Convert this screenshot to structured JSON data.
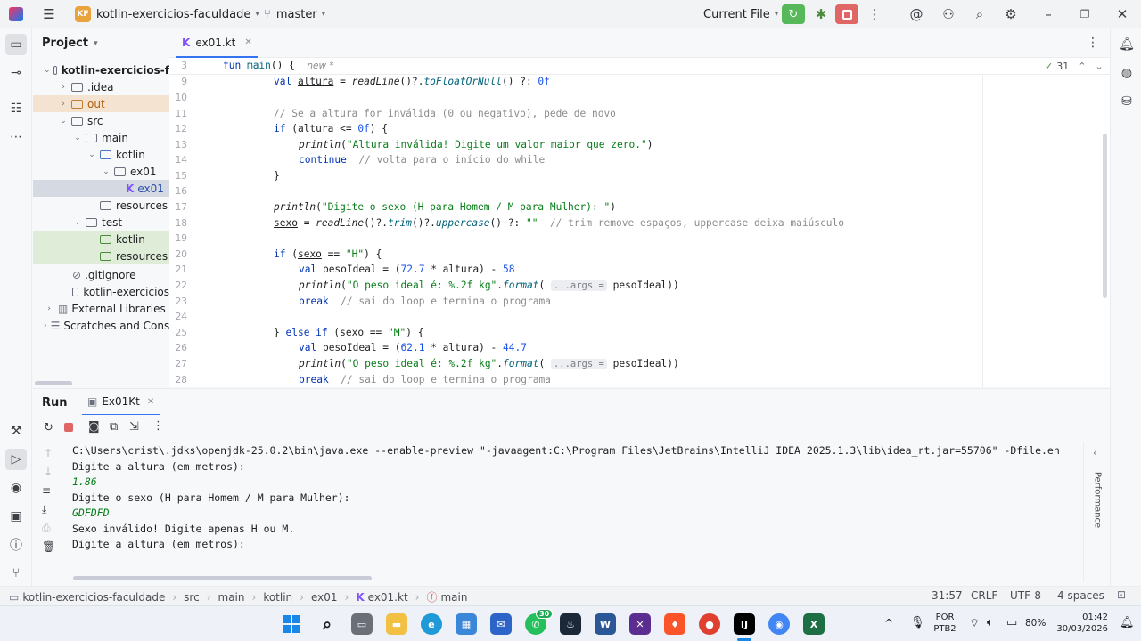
{
  "titlebar": {
    "project_badge": "KF",
    "project_name": "kotlin-exercicios-faculdade",
    "branch": "master",
    "run_config": "Current File"
  },
  "project_panel": {
    "title": "Project",
    "rows": [
      {
        "label": "kotlin-exercicios-f"
      },
      {
        "label": ".idea"
      },
      {
        "label": "out"
      },
      {
        "label": "src"
      },
      {
        "label": "main"
      },
      {
        "label": "kotlin"
      },
      {
        "label": "ex01"
      },
      {
        "label": "ex01"
      },
      {
        "label": "resources"
      },
      {
        "label": "test"
      },
      {
        "label": "kotlin"
      },
      {
        "label": "resources"
      },
      {
        "label": ".gitignore"
      },
      {
        "label": "kotlin-exercicios"
      },
      {
        "label": "External Libraries"
      },
      {
        "label": "Scratches and Cons"
      }
    ]
  },
  "editor": {
    "tab_label": "ex01.kt",
    "sticky": {
      "num": "3",
      "code": "fun main() {",
      "hint": "new *"
    },
    "inspection_count": "31",
    "gutter": [
      "9",
      "10",
      "11",
      "12",
      "13",
      "14",
      "15",
      "16",
      "17",
      "18",
      "19",
      "20",
      "21",
      "22",
      "23",
      "24",
      "25",
      "26",
      "27",
      "28"
    ]
  },
  "run_panel": {
    "title": "Run",
    "tab_label": "Ex01Kt",
    "console": [
      "C:\\Users\\crist\\.jdks\\openjdk-25.0.2\\bin\\java.exe --enable-preview \"-javaagent:C:\\Program Files\\JetBrains\\IntelliJ IDEA 2025.1.3\\lib\\idea_rt.jar=55706\" -Dfile.en",
      "Digite a altura (em metros):",
      "1.86",
      "Digite o sexo (H para Homem / M para Mulher):",
      "GDFDFD",
      "Sexo inválido! Digite apenas H ou M.",
      "Digite a altura (em metros):"
    ],
    "performance_label": "Performance"
  },
  "statusbar": {
    "crumbs": [
      "kotlin-exercicios-faculdade",
      "src",
      "main",
      "kotlin",
      "ex01",
      "ex01.kt",
      "main"
    ],
    "position": "31:57",
    "line_sep": "CRLF",
    "encoding": "UTF-8",
    "indent": "4 spaces"
  },
  "taskbar": {
    "lang_top": "POR",
    "lang_bottom": "PTB2",
    "battery": "80%",
    "time": "01:42",
    "date": "30/03/2026",
    "whatsapp_badge": "30"
  },
  "colors": {
    "accent": "#3574f0",
    "run_green": "#57b85a",
    "stop_red": "#e06666",
    "string_green": "#067d17",
    "keyword_blue": "#0033b3"
  }
}
